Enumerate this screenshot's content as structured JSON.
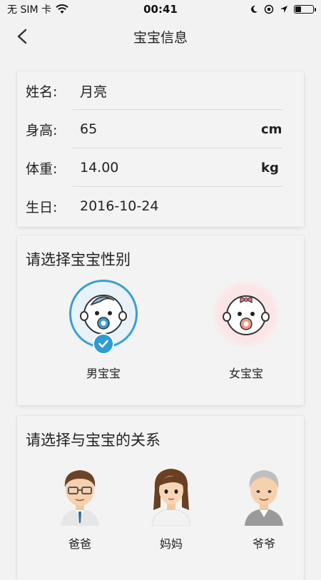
{
  "status_bar": {
    "carrier": "无 SIM 卡",
    "time": "00:41"
  },
  "nav": {
    "title": "宝宝信息"
  },
  "info": {
    "name": {
      "label": "姓名:",
      "value": "月亮"
    },
    "height": {
      "label": "身高:",
      "value": "65",
      "unit": "cm"
    },
    "weight": {
      "label": "体重:",
      "value": "14.00",
      "unit": "kg"
    },
    "birthday": {
      "label": "生日:",
      "value": "2016-10-24"
    }
  },
  "gender": {
    "title": "请选择宝宝性别",
    "boy_label": "男宝宝",
    "girl_label": "女宝宝",
    "selected": "boy"
  },
  "relation": {
    "title": "请选择与宝宝的关系",
    "options": [
      {
        "label": "爸爸"
      },
      {
        "label": "妈妈"
      },
      {
        "label": "爷爷"
      }
    ]
  }
}
